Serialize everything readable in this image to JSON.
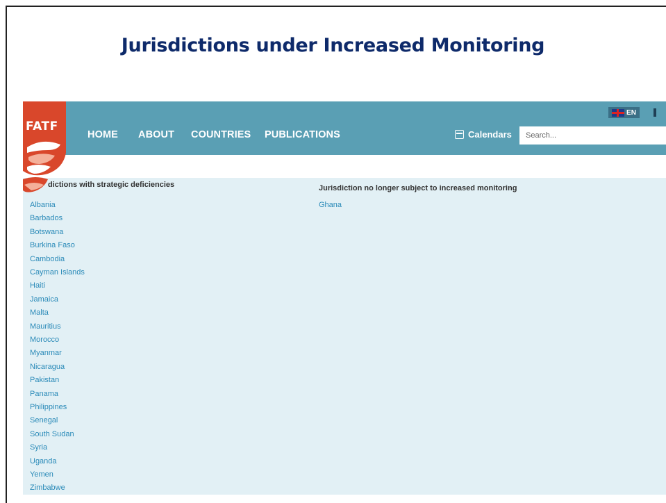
{
  "slide": {
    "title": "Jurisdictions under Increased Monitoring"
  },
  "site": {
    "logo_text": "FATF",
    "nav": [
      "HOME",
      "ABOUT",
      "COUNTRIES",
      "PUBLICATIONS"
    ],
    "calendars_label": "Calendars",
    "search_placeholder": "Search...",
    "language": "EN"
  },
  "lists": {
    "deficiencies_heading": "dictions with strategic deficiencies",
    "removed_heading": "Jurisdiction no longer subject to increased monitoring",
    "deficiencies": [
      "Albania",
      "Barbados",
      "Botswana",
      "Burkina Faso",
      "Cambodia",
      "Cayman Islands",
      "Haiti",
      "Jamaica",
      "Malta",
      "Mauritius",
      "Morocco",
      "Myanmar",
      "Nicaragua",
      "Pakistan",
      "Panama",
      "Philippines",
      "Senegal",
      "South Sudan",
      "Syria",
      "Uganda",
      "Yemen",
      "Zimbabwe"
    ],
    "removed": [
      "Ghana"
    ]
  },
  "colors": {
    "title": "#0e2a6a",
    "navbar": "#5a9fb4",
    "logo_red": "#d9472b",
    "link": "#2a8ab8",
    "content_bg": "#e2f0f5"
  }
}
